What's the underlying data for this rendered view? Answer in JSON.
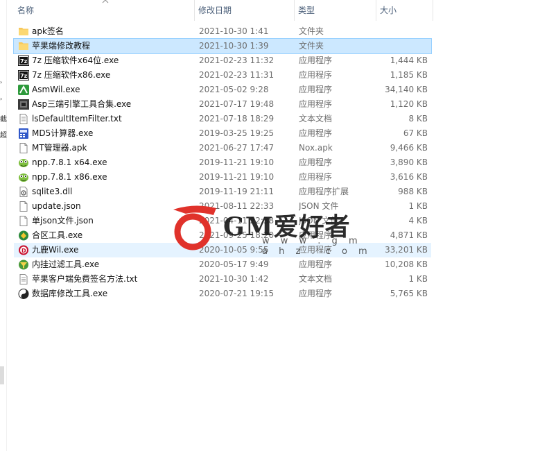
{
  "columns": {
    "name": "名称",
    "date": "修改日期",
    "type": "类型",
    "size": "大小"
  },
  "left_pane_chars": [
    "截",
    "超"
  ],
  "files": [
    {
      "name": "apk签名",
      "date": "2021-10-30 1:41",
      "type": "文件夹",
      "size": "",
      "icon": "folder-icon"
    },
    {
      "name": "苹果端修改教程",
      "date": "2021-10-30 1:39",
      "type": "文件夹",
      "size": "",
      "icon": "folder-icon"
    },
    {
      "name": "7z 压缩软件x64位.exe",
      "date": "2021-02-23 11:32",
      "type": "应用程序",
      "size": "1,444 KB",
      "icon": "7z-app-icon"
    },
    {
      "name": "7z 压缩软件x86.exe",
      "date": "2021-02-23 11:31",
      "type": "应用程序",
      "size": "1,185 KB",
      "icon": "7z-app-icon"
    },
    {
      "name": "AsmWil.exe",
      "date": "2021-05-02 9:28",
      "type": "应用程序",
      "size": "34,140 KB",
      "icon": "asm-app-icon"
    },
    {
      "name": "Asp三端引擎工具合集.exe",
      "date": "2021-07-17 19:48",
      "type": "应用程序",
      "size": "1,120 KB",
      "icon": "dark-app-icon"
    },
    {
      "name": "lsDefaultItemFilter.txt",
      "date": "2021-07-18 18:29",
      "type": "文本文档",
      "size": "8 KB",
      "icon": "text-file-icon"
    },
    {
      "name": "MD5计算器.exe",
      "date": "2019-03-25 19:25",
      "type": "应用程序",
      "size": "67 KB",
      "icon": "md5-app-icon"
    },
    {
      "name": "MT管理器.apk",
      "date": "2021-06-27 17:47",
      "type": "Nox.apk",
      "size": "9,466 KB",
      "icon": "blank-file-icon"
    },
    {
      "name": "npp.7.8.1 x64.exe",
      "date": "2019-11-21 19:10",
      "type": "应用程序",
      "size": "3,890 KB",
      "icon": "npp-app-icon"
    },
    {
      "name": "npp.7.8.1 x86.exe",
      "date": "2019-11-21 19:10",
      "type": "应用程序",
      "size": "3,616 KB",
      "icon": "npp-app-icon"
    },
    {
      "name": "sqlite3.dll",
      "date": "2019-11-19 21:11",
      "type": "应用程序扩展",
      "size": "988 KB",
      "icon": "dll-file-icon"
    },
    {
      "name": "update.json",
      "date": "2021-08-11 22:33",
      "type": "JSON 文件",
      "size": "1 KB",
      "icon": "blank-file-icon"
    },
    {
      "name": "单json文件.json",
      "date": "2021-04-11 22:38",
      "type": "JSON 文件",
      "size": "4 KB",
      "icon": "blank-file-icon"
    },
    {
      "name": "合区工具.exe",
      "date": "2021-09-25 18:20",
      "type": "应用程序",
      "size": "4,871 KB",
      "icon": "merge-app-icon"
    },
    {
      "name": "九鹿Wil.exe",
      "date": "2020-10-05 9:55",
      "type": "应用程序",
      "size": "33,201 KB",
      "icon": "jiulu-app-icon"
    },
    {
      "name": "内挂过滤工具.exe",
      "date": "2020-05-17 9:49",
      "type": "应用程序",
      "size": "10,208 KB",
      "icon": "filter-app-icon"
    },
    {
      "name": "苹果客户端免费签名方法.txt",
      "date": "2021-10-30 1:42",
      "type": "文本文档",
      "size": "1 KB",
      "icon": "text-file-icon"
    },
    {
      "name": "数据库修改工具.exe",
      "date": "2020-07-21 19:15",
      "type": "应用程序",
      "size": "5,765 KB",
      "icon": "db-app-icon"
    }
  ],
  "selected_index": 1,
  "hover_index": 15,
  "watermark": {
    "brand": "GM爱好者",
    "url": "w w w . g m a h z . c o m"
  },
  "colors": {
    "selected_bg": "#cce8ff",
    "selected_border": "#99d1ff",
    "hover_bg": "#e5f3ff",
    "folder": "#f7c75a",
    "watermark_red": "#e0322b"
  }
}
